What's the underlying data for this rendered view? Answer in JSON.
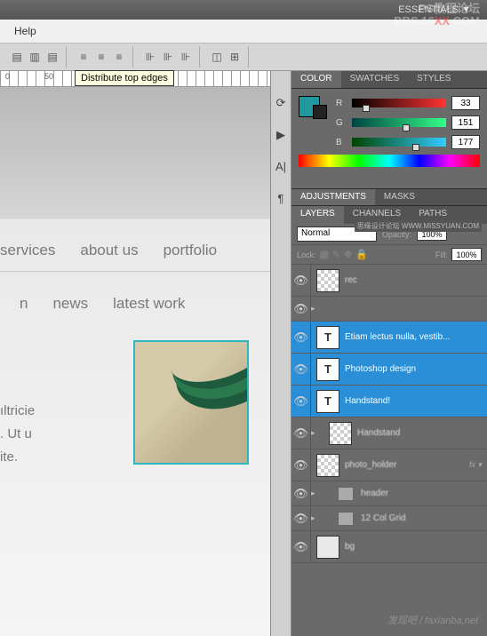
{
  "topbar": {
    "workspace": "ESSENTIALS ▼"
  },
  "watermark": {
    "line1": "PS教程论坛",
    "line2a": "BBS.16",
    "line2b": "XX",
    "line2c": ".COM",
    "bottom": "发现吧 / faxianba.net",
    "mid": "思缘设计论坛  WWW.MISSYUAN.COM"
  },
  "menubar": {
    "help": "Help"
  },
  "toolbar": {
    "tooltip": "Distribute top edges"
  },
  "ruler": {
    "t0": "0",
    "t1": "50"
  },
  "canvas": {
    "nav": [
      "services",
      "about us",
      "portfolio"
    ],
    "nav2_a": "n",
    "nav2_b": "news",
    "nav2_c": "latest work",
    "para_a": "ıltricie",
    "para_b": ". Ut u",
    "para_c": "ite."
  },
  "panels": {
    "color_tabs": [
      "COLOR",
      "SWATCHES",
      "STYLES"
    ],
    "sliders": {
      "r": {
        "label": "R",
        "value": "33",
        "pos": 15
      },
      "g": {
        "label": "G",
        "value": "151",
        "pos": 58
      },
      "b": {
        "label": "B",
        "value": "177",
        "pos": 68
      }
    },
    "adj_tabs": [
      "ADJUSTMENTS",
      "MASKS"
    ],
    "layer_tabs": [
      "LAYERS",
      "CHANNELS",
      "PATHS"
    ],
    "blend_mode": "Normal",
    "opacity_label": "Opacity:",
    "opacity_value": "100%",
    "lock_label": "Lock:",
    "fill_label": "Fill:",
    "fill_value": "100%",
    "layers": [
      {
        "name": "rec",
        "type": "checker",
        "sel": false
      },
      {
        "name": "Etiam lectus nulla, vestib...",
        "type": "T",
        "sel": true
      },
      {
        "name": "Photoshop design",
        "type": "T",
        "sel": true
      },
      {
        "name": "Handstand!",
        "type": "T",
        "sel": true
      },
      {
        "name": "Handstand",
        "type": "checker",
        "sel": false
      },
      {
        "name": "photo_holder",
        "type": "checker",
        "sel": false,
        "fx": "fx ▾"
      },
      {
        "name": "header",
        "type": "folder",
        "sel": false
      },
      {
        "name": "12 Col Grid",
        "type": "folder",
        "sel": false
      },
      {
        "name": "bg",
        "type": "bg",
        "sel": false
      }
    ]
  }
}
